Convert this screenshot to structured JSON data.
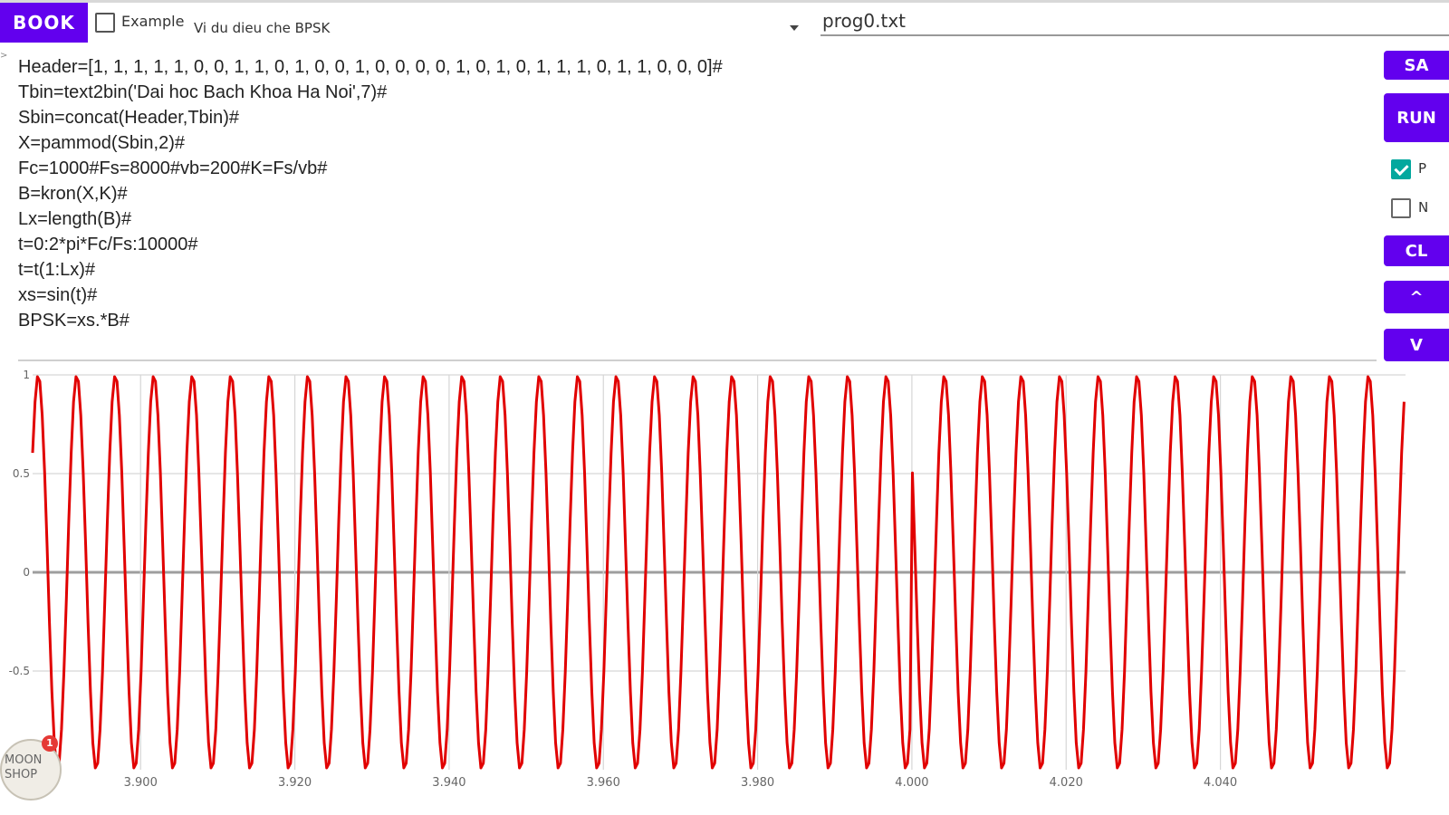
{
  "toolbar": {
    "book_label": "BOOK",
    "example_label": "Example",
    "example_checked": false,
    "example_selected": "Vi du dieu che BPSK",
    "file_name": "prog0.txt"
  },
  "code_tick": ">",
  "code_lines": [
    "Header=[1, 1, 1, 1, 1, 0, 0, 1, 1, 0, 1, 0, 0, 1, 0, 0, 0, 0, 1, 0, 1, 0, 1, 1, 1, 0, 1, 1, 0, 0, 0]#",
    "Tbin=text2bin('Dai hoc Bach Khoa Ha Noi',7)#",
    "Sbin=concat(Header,Tbin)#",
    "X=pammod(Sbin,2)#",
    "Fc=1000#Fs=8000#vb=200#K=Fs/vb#",
    "B=kron(X,K)#",
    "Lx=length(B)#",
    "t=0:2*pi*Fc/Fs:10000#",
    "t=t(1:Lx)#",
    "xs=sin(t)#",
    "BPSK=xs.*B#"
  ],
  "side": {
    "sa_label": "SA",
    "run_label": "RUN",
    "p_label": "P",
    "p_checked": true,
    "n_label": "N",
    "n_checked": false,
    "cl_label": "CL",
    "up_label": "^",
    "down_label": "V"
  },
  "badge": {
    "text": "MOON SHOP",
    "count": "1"
  },
  "chart_data": {
    "type": "line",
    "series": [
      {
        "color": "#e10000",
        "description": "BPSK = sin(t) .* B, carrier period 8 samples; phase flip at x = 4.000",
        "freq_cycles_per_unit": 200,
        "phase_flip_at": 4.0
      }
    ],
    "x_ticks": [
      "3.900",
      "3.920",
      "3.940",
      "3.960",
      "3.980",
      "4.000",
      "4.020",
      "4.040"
    ],
    "x_tick_values": [
      3.9,
      3.92,
      3.94,
      3.96,
      3.98,
      4.0,
      4.02,
      4.04
    ],
    "y_ticks": [
      "1",
      "0.5",
      "0",
      "-0.5"
    ],
    "y_tick_values": [
      1,
      0.5,
      0,
      -0.5
    ],
    "xlim": [
      3.886,
      4.064
    ],
    "ylim": [
      -1,
      1
    ],
    "grid": true,
    "line_color": "#e10000",
    "zero_line_color": "#9e9e9e",
    "grid_color": "#d6d6d6"
  }
}
